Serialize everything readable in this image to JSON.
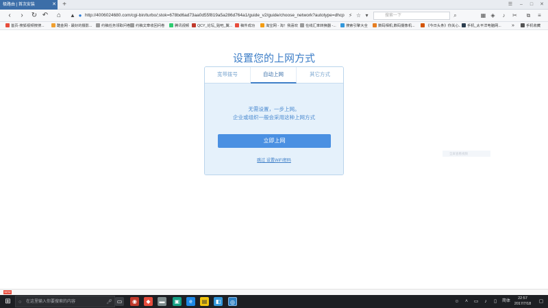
{
  "browser": {
    "tab_title": "极路由 | 首次安装",
    "new_tab_symbol": "+",
    "url": "http://4006024680.com/cgi-bin/turbo/;stok=678bd6ad73aa0d55f819a5a286d764a1/guide_v2/guide/choose_network?autotype=dhcp",
    "search_placeholder": "搜索一下"
  },
  "bookmarks": [
    {
      "label": "首页-搜狐视频搜搜...",
      "color": "#e74c3c"
    },
    {
      "label": "酷金网 - 最好的摄影...",
      "color": "#f0a030"
    },
    {
      "label": "约稿任务领取问卷",
      "color": "#999999"
    },
    {
      "label": "约稿文章收回问卷",
      "color": "#999999"
    },
    {
      "label": "腾讯视频",
      "color": "#2ecc71"
    },
    {
      "label": "QCY_论坛_贴吧_翼...",
      "color": "#c0392b"
    },
    {
      "label": "稿件成功",
      "color": "#e74c3c"
    },
    {
      "label": "淘宝网 - 淘！我喜欢",
      "color": "#f39c12"
    },
    {
      "label": "在线汇率转换器 -...",
      "color": "#999999"
    },
    {
      "label": "搜索引擎大全",
      "color": "#3498db"
    },
    {
      "label": "数码相机,数码摄像机...",
      "color": "#e67e22"
    },
    {
      "label": "《今日头条》你关心...",
      "color": "#d35400"
    },
    {
      "label": "手机_太平洋电脑网...",
      "color": "#2c3e50"
    },
    {
      "label": "手机收藏",
      "color": "#555555"
    }
  ],
  "page": {
    "title": "设置您的上网方式",
    "tabs": [
      "宽带拨号",
      "自动上网",
      "其它方式"
    ],
    "active_tab": "自动上网",
    "desc_line1": "无需设置，一步上网。",
    "desc_line2": "企业或组织一般会采用这种上网方式",
    "connect_button": "立即上网",
    "skip_link": "跳过 设置WiFi密码",
    "faint_text": "全屏查看视频"
  },
  "taskbar": {
    "search_placeholder": "在这里输入你要搜索的内容",
    "ime": "简体",
    "time": "22:57",
    "date": "2017/7/18"
  },
  "colors": {
    "accent": "#3d7ec7",
    "button": "#4a90e2",
    "panel_bg": "#e5f1fb",
    "tab_active_bg": "#3c6ea8",
    "taskbar_bg": "#1d1f23"
  }
}
